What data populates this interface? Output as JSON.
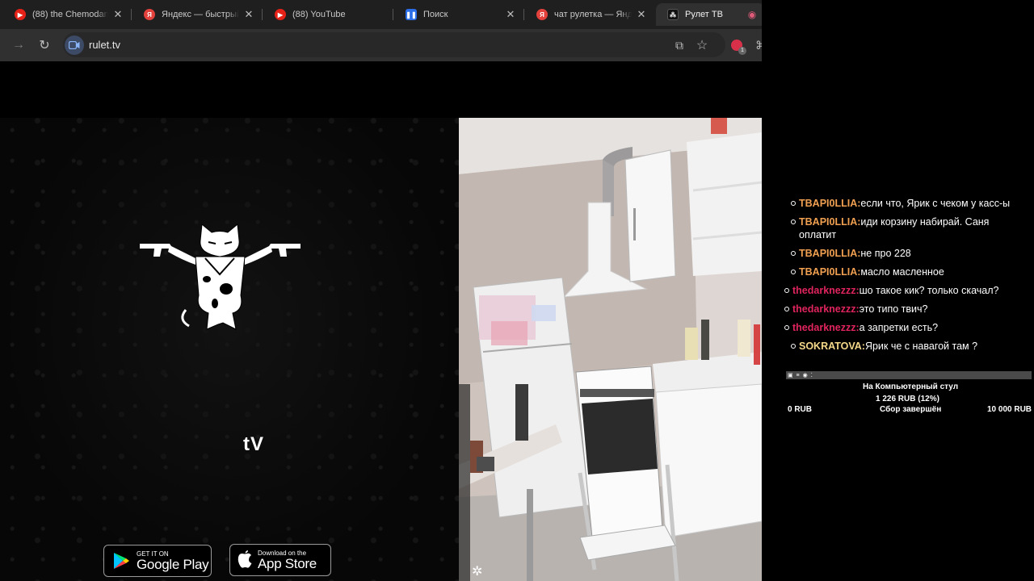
{
  "browser": {
    "tabs": [
      {
        "title": "(88) the Chemodan -",
        "favicon": "youtube-icon",
        "color": "#e62117"
      },
      {
        "title": "Яндекс — быстрый поиск",
        "favicon": "yandex-icon",
        "color": "#e2413c"
      },
      {
        "title": "(88) YouTube",
        "favicon": "youtube-icon",
        "color": "#e62117"
      },
      {
        "title": "Поиск",
        "favicon": "pause-icon",
        "color": "#2b6ee6"
      },
      {
        "title": "чат рулетка — Яндекс",
        "favicon": "yandex-icon",
        "color": "#e2413c"
      },
      {
        "title": "Рулет ТВ",
        "favicon": "rulet-icon",
        "color": "#111111",
        "active": true
      }
    ],
    "address": "rulet.tv"
  },
  "site": {
    "tv_letters": "tV",
    "google_play": {
      "small": "GET IT ON",
      "big": "Google Play"
    },
    "app_store": {
      "small": "Download on the",
      "big": "App Store"
    }
  },
  "chat": {
    "messages": [
      {
        "nick": "TBAPI0LLIA:",
        "text": "если что, Ярик с чеком у касс-ы",
        "color": "#f0a050"
      },
      {
        "nick": "TBAPI0LLIA:",
        "text": "иди корзину набирай. Саня оплатит",
        "color": "#f0a050"
      },
      {
        "nick": "TBAPI0LLIA:",
        "text": "не про 228",
        "color": "#f0a050"
      },
      {
        "nick": "TBAPI0LLIA:",
        "text": "масло масленное",
        "color": "#f0a050"
      },
      {
        "nick": "thedarknezzz:",
        "text": "шо такое кик? только скачал?",
        "color": "#e0245e"
      },
      {
        "nick": "thedarknezzz:",
        "text": "это типо твич?",
        "color": "#e0245e"
      },
      {
        "nick": "thedarknezzz:",
        "text": "а запретки есть?",
        "color": "#e0245e"
      },
      {
        "nick": "SOKRATOVA:",
        "text": "Ярик че с навагой там ?",
        "color": "#f5d98a"
      }
    ],
    "goal": {
      "title": "На Компьютерный стул",
      "collected": "1 226 RUB (12%)",
      "min": "0 RUB",
      "status": "Сбор завершён",
      "max": "10 000 RUB"
    }
  }
}
